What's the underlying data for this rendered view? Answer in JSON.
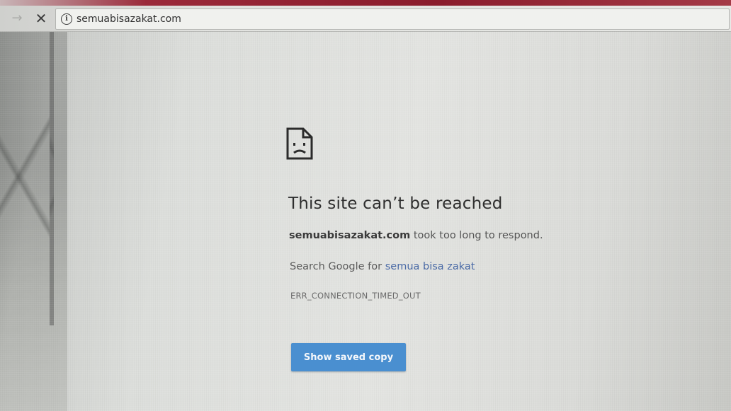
{
  "toolbar": {
    "forward_icon": "arrow-right-icon",
    "stop_icon": "close-icon",
    "stop_glyph": "✕",
    "forward_glyph": "→",
    "info_glyph": "i",
    "url": "semuabisazakat.com"
  },
  "error_page": {
    "icon": "sad-file-icon",
    "title": "This site can’t be reached",
    "host": "semuabisazakat.com",
    "description_suffix": " took too long to respond.",
    "search_prefix": "Search Google for ",
    "search_query": "semua bisa zakat",
    "error_code": "ERR_CONNECTION_TIMED_OUT",
    "button_label": "Show saved copy"
  },
  "colors": {
    "accent_button": "#4a8fd0",
    "title_text": "#2e2e2e",
    "frame_red": "#8a1c2c"
  }
}
